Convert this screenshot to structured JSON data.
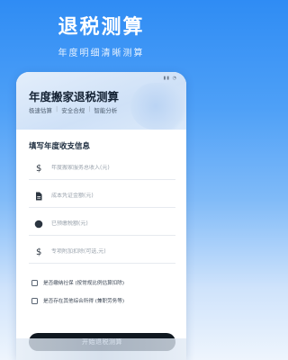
{
  "hero": {
    "title": "退税测算",
    "subtitle": "年度明细清晰测算"
  },
  "app": {
    "title": "年度搬家退税测算",
    "tags": [
      "极速估算",
      "安全合规",
      "智能分析"
    ]
  },
  "form": {
    "title": "填写年度收支信息",
    "fields": [
      {
        "icon": "dollar-icon",
        "placeholder": "年度搬家服务总收入(元)"
      },
      {
        "icon": "document-icon",
        "placeholder": "成本凭证金额(元)"
      },
      {
        "icon": "prepaid-icon",
        "placeholder": "已预缴税额(元)"
      },
      {
        "icon": "dollar-icon",
        "placeholder": "专项附加扣除(可选,元)"
      }
    ],
    "checkboxes": [
      {
        "label": "是否缴纳社保 (按常规比例估算扣除)",
        "checked": false
      },
      {
        "label": "是否存在其他综合所得 (兼职劳务等)",
        "checked": false
      }
    ],
    "submit_label": "开始退税测算"
  },
  "colors": {
    "primary": "#2f8cf4",
    "button": "#101820"
  }
}
